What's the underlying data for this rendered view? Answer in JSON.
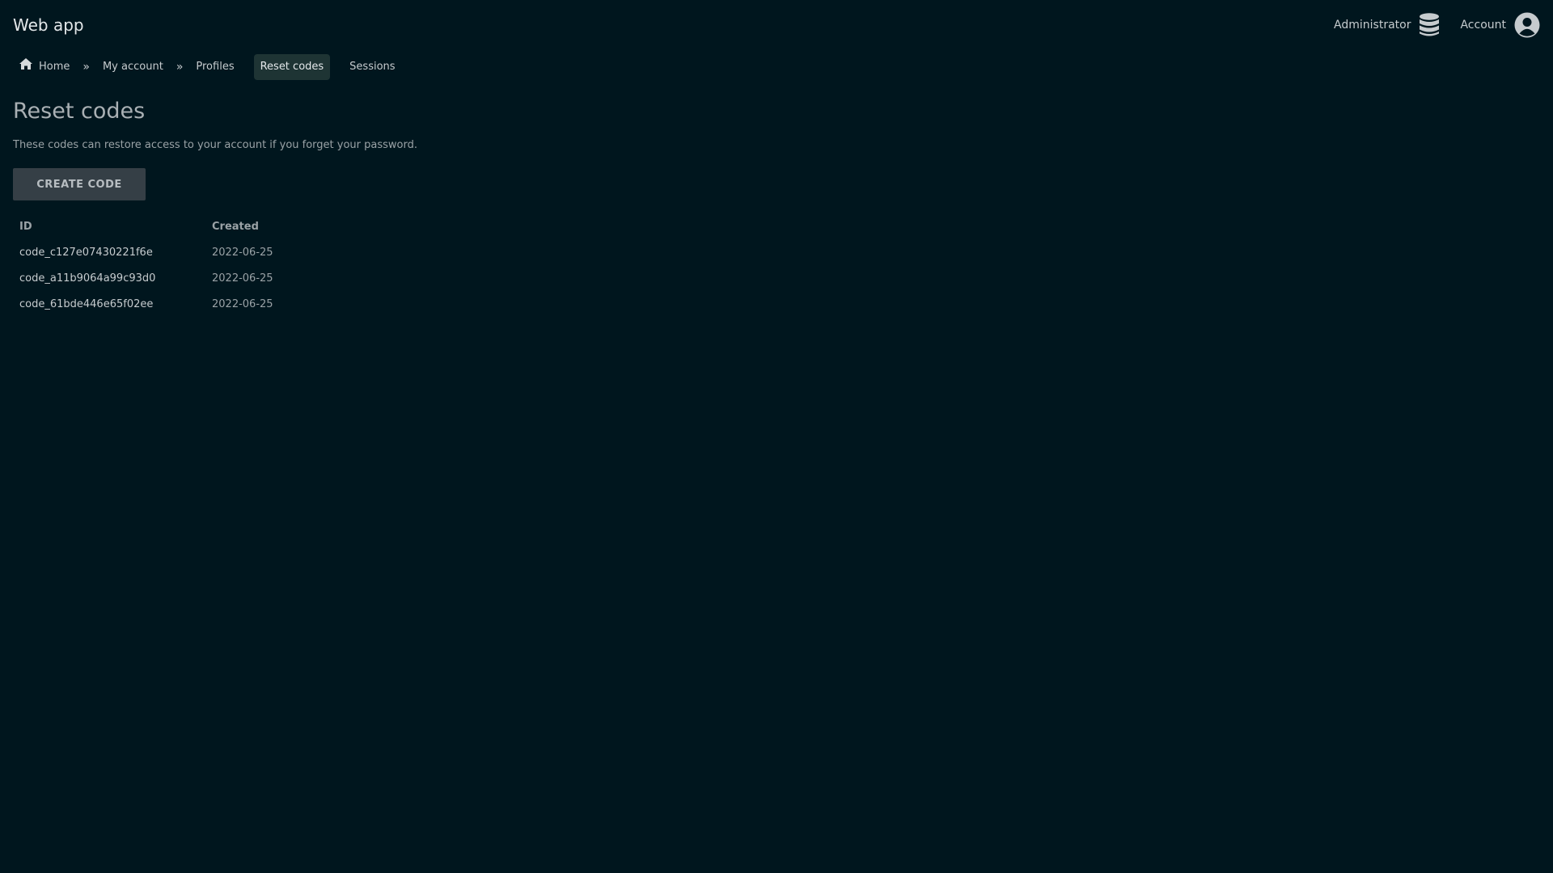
{
  "app": {
    "title": "Web app"
  },
  "header": {
    "admin_label": "Administrator",
    "admin_icon": "database-icon",
    "account_label": "Account",
    "account_icon": "user-circle-icon"
  },
  "breadcrumb": {
    "home": "Home",
    "home_icon": "home-icon",
    "separator": "»",
    "my_account": "My account",
    "profiles": "Profiles",
    "reset_codes": "Reset codes",
    "sessions": "Sessions"
  },
  "main": {
    "title": "Reset codes",
    "subtitle": "These codes can restore access to your account if you forget your password.",
    "create_button": "CREATE CODE"
  },
  "table": {
    "columns": [
      "ID",
      "Created"
    ],
    "rows": [
      {
        "id": "code_c127e07430221f6e",
        "created": "2022-06-25"
      },
      {
        "id": "code_a11b9064a99c93d0",
        "created": "2022-06-25"
      },
      {
        "id": "code_61bde446e65f02ee",
        "created": "2022-06-25"
      }
    ]
  },
  "colors": {
    "background": "#00161e",
    "active_crumb": "#1e3434",
    "button": "#353f46"
  }
}
